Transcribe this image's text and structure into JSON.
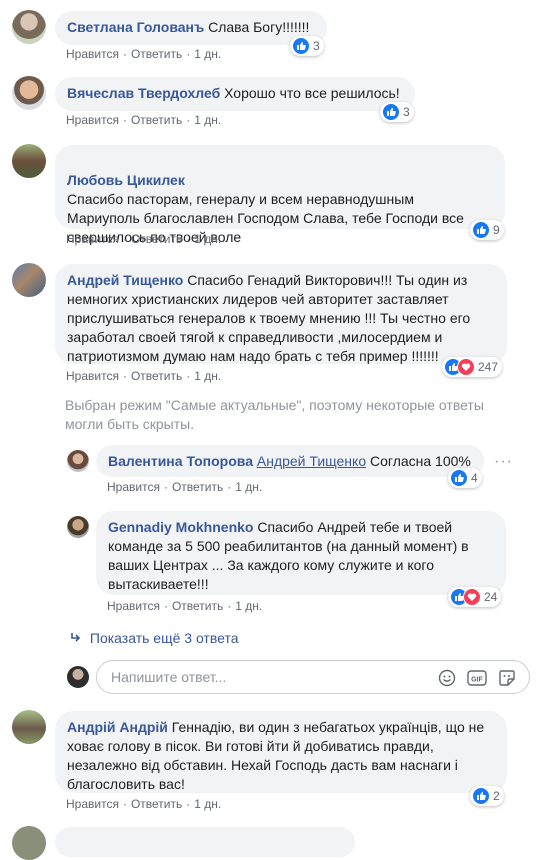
{
  "comments": [
    {
      "author": "Светлана Голованъ",
      "text": "Слава Богу!!!!!!!",
      "like": "Нравится",
      "reply": "Ответить",
      "time": "1 дн.",
      "reactions": "3"
    },
    {
      "author": "Вячеслав Твердохлеб",
      "text": "Хорошо что все решилось!",
      "like": "Нравится",
      "reply": "Ответить",
      "time": "1 дн.",
      "reactions": "3"
    },
    {
      "author": "Любовь Цикилек",
      "text": "Спасибо пасторам, генералу и всем неравнодушным\nМариуполь благославлен Господом Слава, тебе Господи все свершилось по твоей воле",
      "like": "Нравится",
      "reply": "Ответить",
      "time": "1 дн.",
      "reactions": "9"
    },
    {
      "author": "Андрей Тищенко",
      "text": "Спасибо Генадий Викторович!!! Ты один из немногих христианских лидеров чей авторитет заставляет прислушиваться генералов к твоему мнению !!! Ты честно его заработал своей тягой к справедливости ,милосердием и патриотизмом думаю нам надо брать с тебя пример !!!!!!!",
      "like": "Нравится",
      "reply": "Ответить",
      "time": "1 дн.",
      "reactions": "247"
    },
    {
      "author": "Андрій Андрій",
      "text": "Геннадію, ви один з небагатьох українців, що не ховає голову в пісок. Ви готові йти й добиватись правди, незалежно від обставин. Нехай Господь дасть вам наснаги і благословить вас!",
      "like": "Нравится",
      "reply": "Ответить",
      "time": "1 дн.",
      "reactions": "2"
    }
  ],
  "notice": "Выбран режим \"Самые актуальные\", поэтому некоторые ответы могли быть скрыты.",
  "replies": [
    {
      "author": "Валентина Топорова",
      "mention": "Андрей Тищенко",
      "text": "Согласна 100%",
      "like": "Нравится",
      "reply": "Ответить",
      "time": "1 дн.",
      "reactions": "4"
    },
    {
      "author": "Gennadiy Mokhnenko",
      "text": "Спасибо Андрей тебе и твоей команде за 5 500 реабилитантов (на данный момент) в ваших Центрах ... За каждого кому служите и кого вытаскиваете!!!",
      "like": "Нравится",
      "reply": "Ответить",
      "time": "1 дн.",
      "reactions": "24"
    }
  ],
  "show_more": "Показать ещё 3 ответа",
  "reply_input": {
    "placeholder": "Напишите ответ...",
    "value": ""
  },
  "icons": {
    "like": "thumbs-up-icon",
    "love": "heart-icon",
    "emoji": "emoji-icon",
    "gif": "gif-icon",
    "sticker": "sticker-icon",
    "more": "more-options-icon",
    "arrow": "reply-arrow-icon"
  },
  "colors": {
    "author": "#385898",
    "like": "#1877f2",
    "love": "#f33e58",
    "bubble": "#f2f3f5"
  }
}
